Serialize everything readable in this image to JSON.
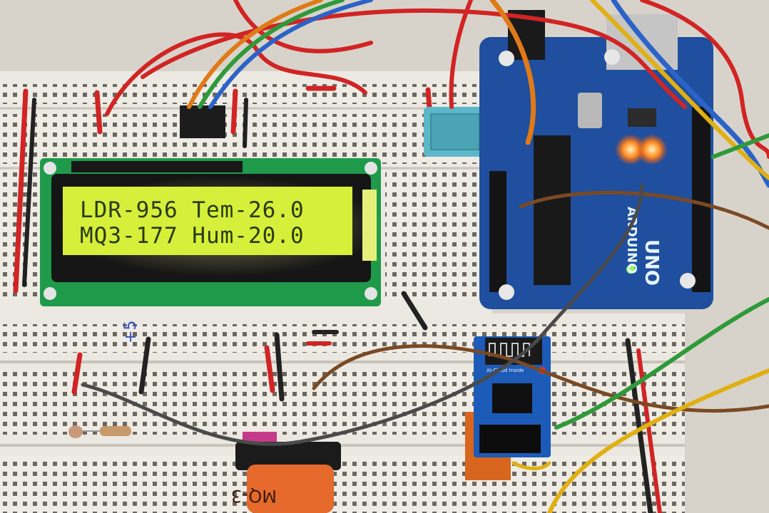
{
  "lcd": {
    "line1": "LDR-956 Tem-26.0",
    "line2": "MQ3-177 Hum-20.0",
    "backlight_color": "#d6ef3a"
  },
  "sensor_module": {
    "label": "MQ-3"
  },
  "wifi_module": {
    "label": "AI-Cloud Inside"
  },
  "arduino": {
    "label": "ARDUINO",
    "model": "UNO",
    "board_color": "#1f4f9e"
  },
  "breadboard": {
    "handwritten_mark": "+5"
  }
}
